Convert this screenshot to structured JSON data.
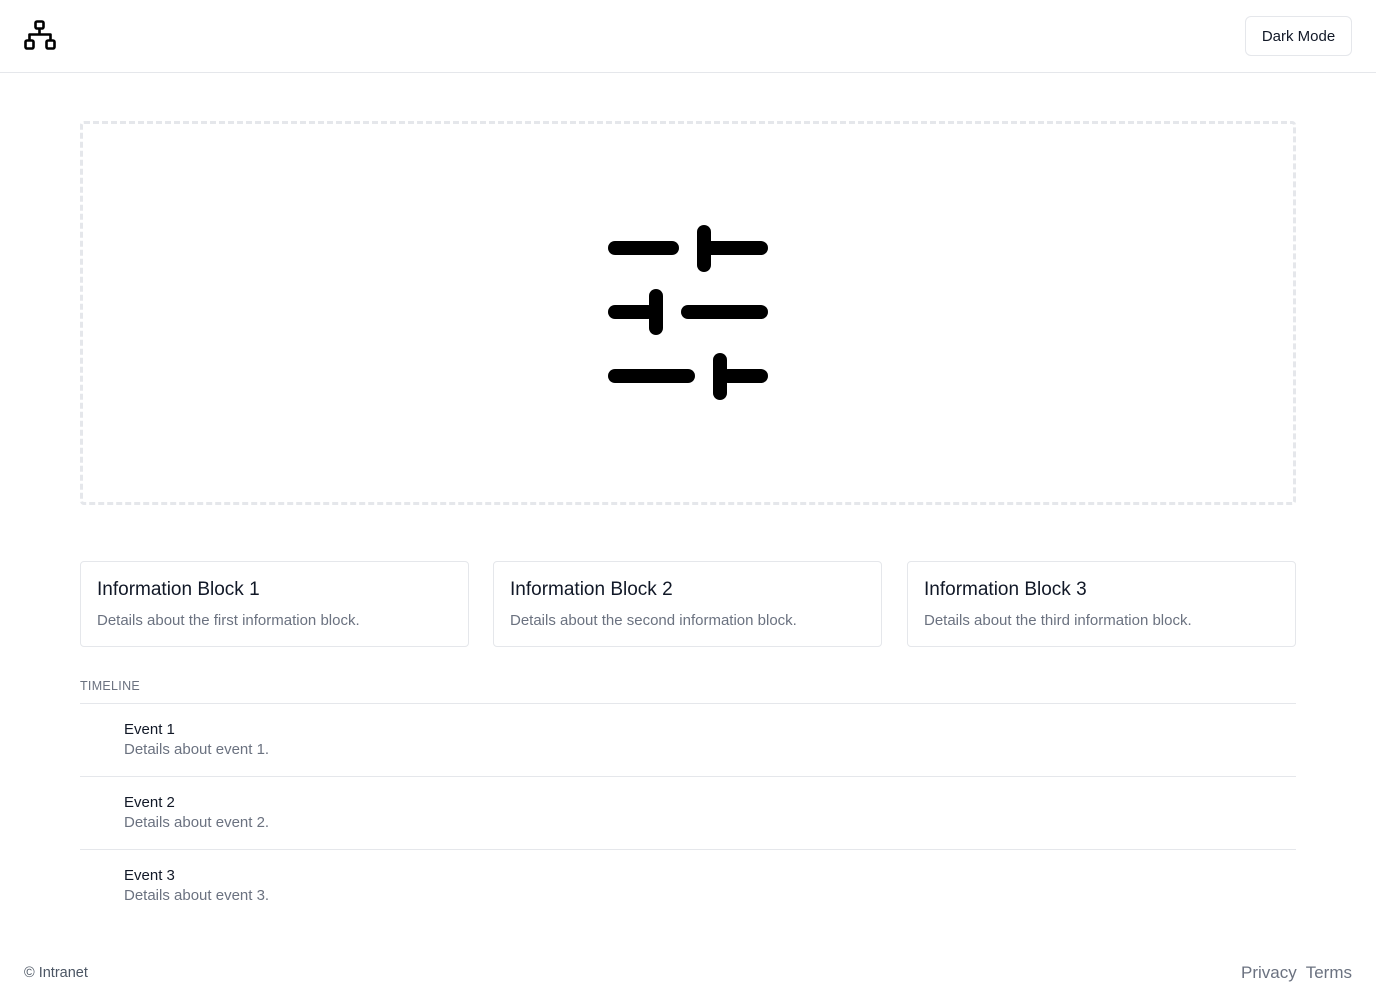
{
  "header": {
    "logo_icon": "sitemap-icon",
    "dark_mode_label": "Dark Mode"
  },
  "hero": {
    "icon": "sliders-icon"
  },
  "info_blocks": [
    {
      "title": "Information Block 1",
      "description": "Details about the first information block."
    },
    {
      "title": "Information Block 2",
      "description": "Details about the second information block."
    },
    {
      "title": "Information Block 3",
      "description": "Details about the third information block."
    }
  ],
  "timeline": {
    "label": "TIMELINE",
    "events": [
      {
        "title": "Event 1",
        "description": "Details about event 1."
      },
      {
        "title": "Event 2",
        "description": "Details about event 2."
      },
      {
        "title": "Event 3",
        "description": "Details about event 3."
      }
    ]
  },
  "footer": {
    "copyright": "© Intranet",
    "links": [
      "Privacy",
      "Terms"
    ]
  },
  "colors": {
    "border": "#e5e7eb",
    "text_primary": "#111827",
    "text_muted": "#6b7280"
  }
}
